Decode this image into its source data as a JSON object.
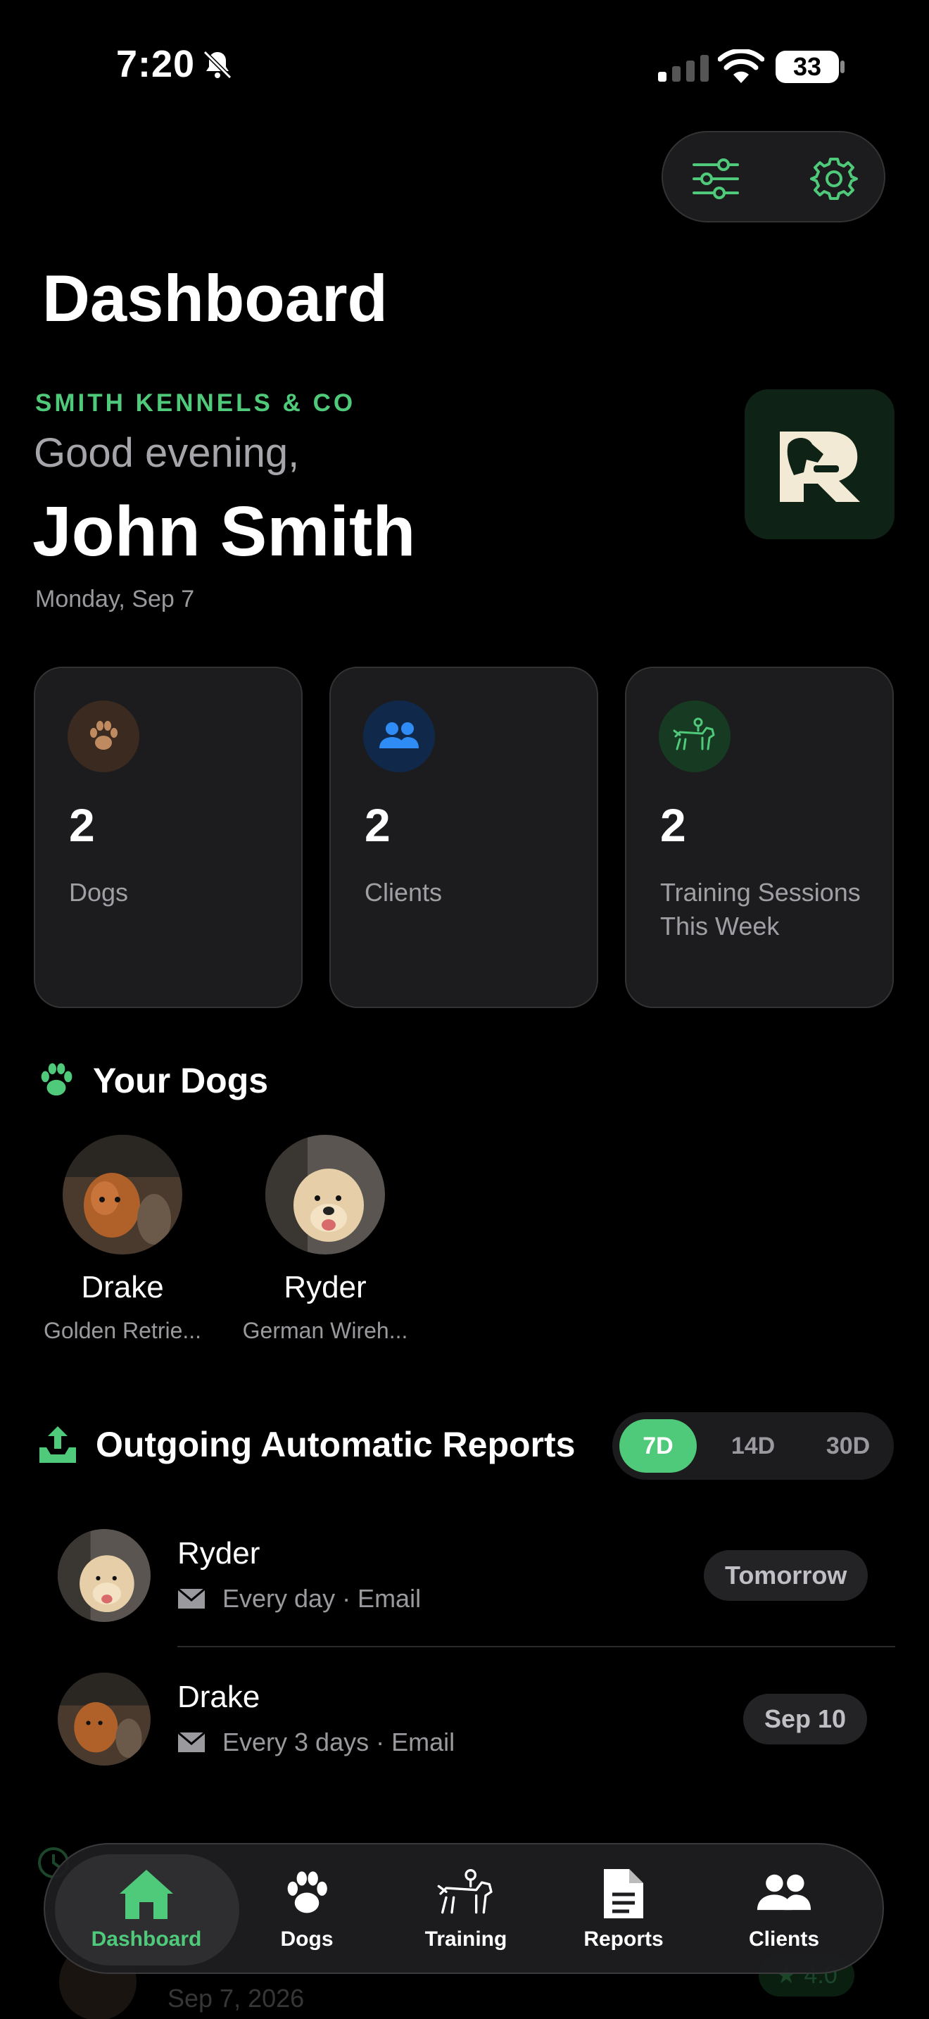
{
  "status": {
    "time": "7:20",
    "battery": "33"
  },
  "title": "Dashboard",
  "header": {
    "kennel": "SMITH KENNELS & CO",
    "greeting": "Good evening,",
    "user": "John Smith",
    "date": "Monday, Sep 7"
  },
  "stats": [
    {
      "value": "2",
      "label": "Dogs",
      "icon": "paw-icon",
      "color": "#c08a60"
    },
    {
      "value": "2",
      "label": "Clients",
      "icon": "people-icon",
      "color": "#2f8cf5"
    },
    {
      "value": "2",
      "label": "Training Sessions This Week",
      "icon": "dog-training-icon",
      "color": "#4fc97a"
    }
  ],
  "dogs_section": {
    "title": "Your Dogs",
    "dogs": [
      {
        "name": "Drake",
        "breed": "Golden Retrie..."
      },
      {
        "name": "Ryder",
        "breed": "German Wireh..."
      }
    ]
  },
  "reports_section": {
    "title": "Outgoing Automatic Reports",
    "ranges": [
      "7D",
      "14D",
      "30D"
    ],
    "selected_range": "7D",
    "items": [
      {
        "name": "Ryder",
        "schedule": "Every day · Email",
        "when": "Tomorrow"
      },
      {
        "name": "Drake",
        "schedule": "Every 3 days · Email",
        "when": "Sep 10"
      }
    ]
  },
  "behind_tabbar": {
    "date": "Sep 7, 2026",
    "rating": "4.0"
  },
  "tabs": [
    {
      "label": "Dashboard",
      "active": true
    },
    {
      "label": "Dogs",
      "active": false
    },
    {
      "label": "Training",
      "active": false
    },
    {
      "label": "Reports",
      "active": false
    },
    {
      "label": "Clients",
      "active": false
    }
  ],
  "colors": {
    "accent": "#4fc97a",
    "background": "#000000",
    "card": "#1c1c1e"
  }
}
